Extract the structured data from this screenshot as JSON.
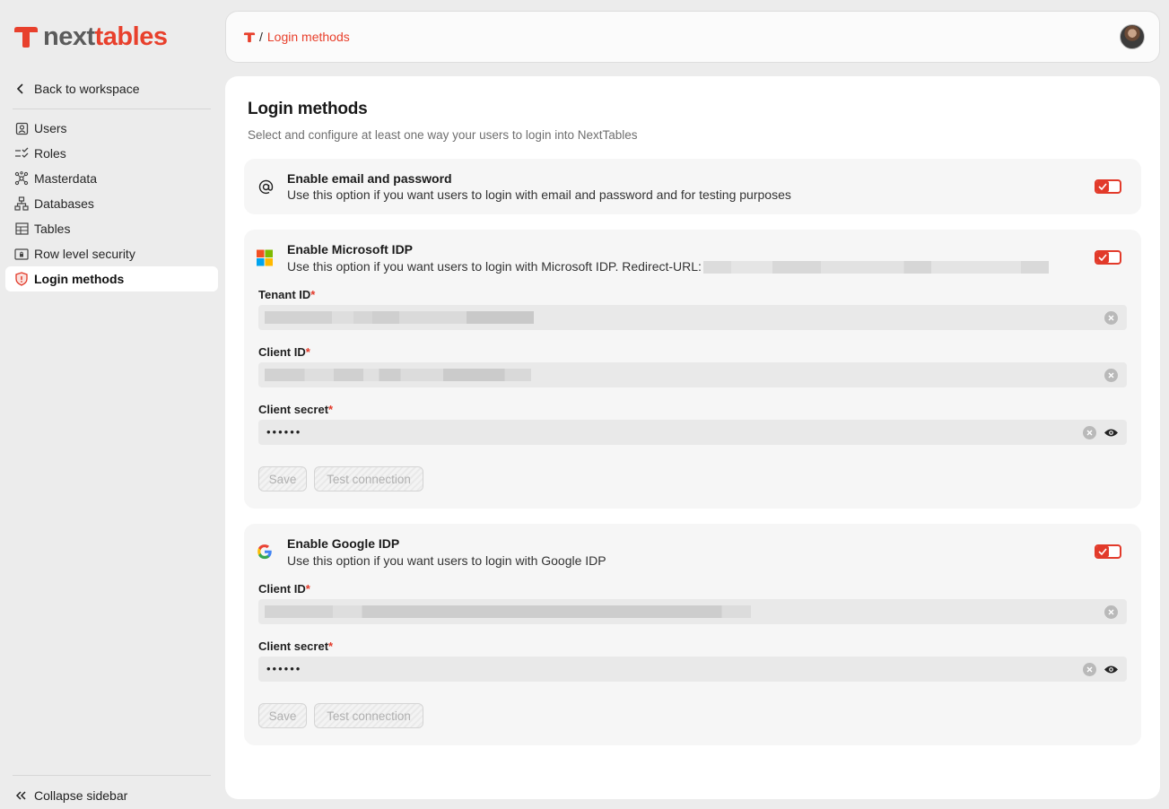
{
  "brand": {
    "part1": "next",
    "part2": "tables",
    "accent": "#e8402c"
  },
  "sidebar": {
    "back_label": "Back to workspace",
    "items": [
      {
        "label": "Users",
        "icon": "user-badge-icon"
      },
      {
        "label": "Roles",
        "icon": "list-check-icon"
      },
      {
        "label": "Masterdata",
        "icon": "network-icon"
      },
      {
        "label": "Databases",
        "icon": "hierarchy-icon"
      },
      {
        "label": "Tables",
        "icon": "table-icon"
      },
      {
        "label": "Row level security",
        "icon": "row-lock-icon"
      },
      {
        "label": "Login methods",
        "icon": "shield-icon",
        "active": true
      }
    ],
    "collapse_label": "Collapse sidebar"
  },
  "header": {
    "crumb_sep": "/",
    "crumb_label": "Login methods"
  },
  "page": {
    "title": "Login methods",
    "subtitle": "Select and configure at least one way your users to login into NextTables"
  },
  "email_card": {
    "title": "Enable email and password",
    "desc": "Use this option if you want users to login with email and password and for testing purposes",
    "enabled": true
  },
  "microsoft_card": {
    "title": "Enable Microsoft IDP",
    "desc": "Use this option if you want users to login with Microsoft IDP. Redirect-URL:",
    "enabled": true,
    "tenant_label": "Tenant ID",
    "client_label": "Client ID",
    "secret_label": "Client secret",
    "secret_value": "••••••",
    "save_label": "Save",
    "test_label": "Test connection"
  },
  "google_card": {
    "title": "Enable Google IDP",
    "desc": "Use this option if you want users to login with Google IDP",
    "enabled": true,
    "client_label": "Client ID",
    "secret_label": "Client secret",
    "secret_value": "••••••",
    "save_label": "Save",
    "test_label": "Test connection"
  },
  "required_mark": "*"
}
